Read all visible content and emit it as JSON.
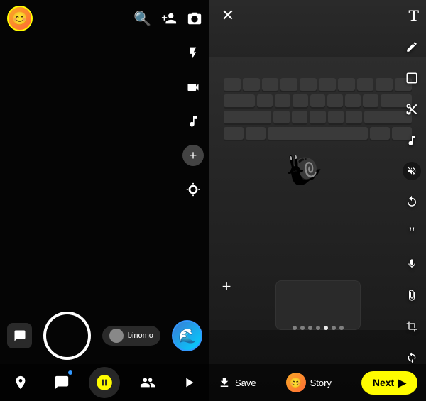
{
  "left": {
    "avatar_emoji": "😊",
    "top_icons": {
      "search": "🔍",
      "add_friend": "👤",
      "camera_flip": "⬛"
    },
    "sidebar": {
      "flash": "⚡",
      "video": "📹",
      "music": "🎵",
      "plus": "+",
      "focus": "◎"
    },
    "lens_label": "binomo",
    "bottom_nav": {
      "map": "📍",
      "chat": "💬",
      "snap": "⭐",
      "friends": "👥",
      "discover": "▷"
    }
  },
  "right": {
    "close": "✕",
    "text_tool": "T",
    "toolbar": {
      "pencil": "✏",
      "sticker": "□",
      "scissors": "✂",
      "music": "♪",
      "mute": "🔇",
      "rotate": "↻",
      "quote": "❝",
      "mic": "🎤",
      "paperclip": "📎",
      "crop": "⊡",
      "loop": "↻"
    },
    "add_btn": "+",
    "dots": [
      false,
      false,
      false,
      false,
      true,
      false,
      false
    ],
    "bottom": {
      "save_label": "Save",
      "story_label": "Story",
      "next_label": "Next",
      "next_arrow": "▶"
    }
  }
}
